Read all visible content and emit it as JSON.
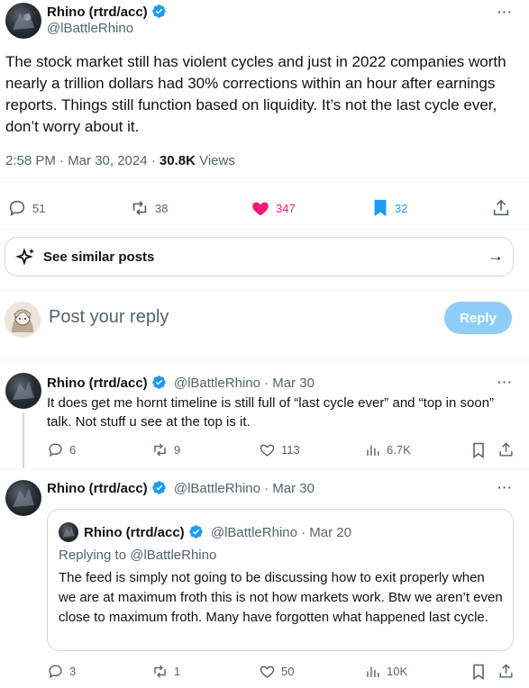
{
  "main_post": {
    "author_name": "Rhino (rtrd/acc)",
    "handle": "@lBattleRhino",
    "text": "The stock market still has violent cycles and just in 2022 companies worth nearly a trillion dollars had 30% corrections within an hour after earnings reports. Things still function based on liquidity. It’s not the last cycle ever, don’t worry about it.",
    "time": "2:58 PM · Mar 30, 2024 · ",
    "views_count": "30.8K",
    "views_label": " Views",
    "replies": "51",
    "reposts": "38",
    "likes": "347",
    "bookmarks": "32",
    "more": "···"
  },
  "similar": {
    "label": "See similar posts",
    "arrow": "→"
  },
  "composer": {
    "placeholder": "Post your reply",
    "reply_button": "Reply"
  },
  "replies": [
    {
      "author_name": "Rhino (rtrd/acc)",
      "meta": "@lBattleRhino · Mar 30",
      "text": "It does get me hornt timeline is still full of “last cycle ever” and “top in soon” talk. Not stuff u see at the top is it.",
      "replies": "6",
      "reposts": "9",
      "likes": "113",
      "views": "6.7K",
      "more": "···"
    },
    {
      "author_name": "Rhino (rtrd/acc)",
      "meta": "@lBattleRhino · Mar 30",
      "more": "···",
      "quote": {
        "author_name": "Rhino (rtrd/acc)",
        "meta": "@lBattleRhino · Mar 20",
        "replying_to": "Replying to @lBattleRhino",
        "text": "The feed is simply not going to be discussing how to exit properly when we are at maximum froth this is not how markets work. Btw we aren’t even close to maximum froth. Many have forgotten what happened last cycle."
      },
      "replies": "3",
      "reposts": "1",
      "likes": "50",
      "views": "10K"
    }
  ],
  "colors": {
    "accent": "#1d9bf0",
    "like": "#f91880",
    "muted": "#536471",
    "reply_disabled": "#8ecdf8"
  },
  "icons": [
    "verified-badge-icon",
    "more-icon",
    "reply-icon",
    "repost-icon",
    "heart-icon",
    "bookmark-icon",
    "share-icon",
    "sparkle-icon",
    "arrow-right-icon",
    "views-icon"
  ]
}
